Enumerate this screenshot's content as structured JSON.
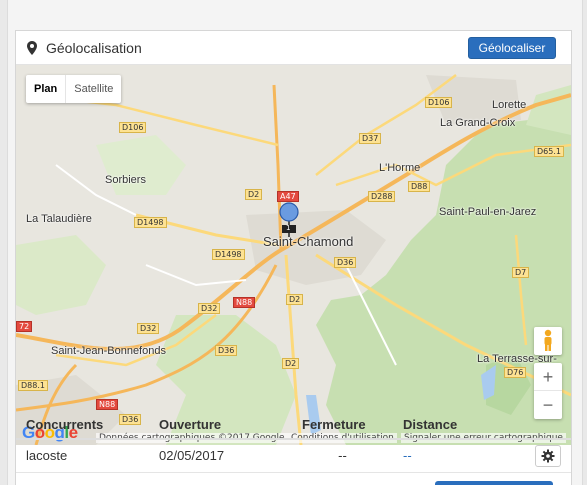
{
  "panel": {
    "title": "Géolocalisation",
    "geolocate_button": "Géolocaliser"
  },
  "map": {
    "type_plan": "Plan",
    "type_satellite": "Satellite",
    "zoom_in": "+",
    "zoom_out": "−",
    "google": "Google",
    "attrib_data": "Données cartographiques ©2017 Google",
    "attrib_terms": "Conditions d'utilisation",
    "attrib_report": "Signaler une erreur cartographique",
    "cities": {
      "lorette": "Lorette",
      "la_grand_croix": "La Grand-Croix",
      "sorbiers": "Sorbiers",
      "lhorme": "L'Horme",
      "la_talaudiere": "La Talaudière",
      "saint_paul": "Saint-Paul-en-Jarez",
      "saint_chamond": "Saint-Chamond",
      "saint_jean": "Saint-Jean-Bonnefonds",
      "la_terrasse": "La Terrasse-sur-"
    },
    "roads": {
      "d106a": "D106",
      "d106b": "D106",
      "d37": "D37",
      "d651": "D65.1",
      "d2a": "D2",
      "a47": "A47",
      "d288": "D288",
      "d88": "D88",
      "d1498a": "D1498",
      "d1498b": "D1498",
      "d36a": "D36",
      "d7": "D7",
      "n88a": "N88",
      "d32a": "D32",
      "d2b": "D2",
      "n72": "72",
      "d32b": "D32",
      "d36b": "D36",
      "d2c": "D2",
      "d76": "D76",
      "d881": "D88.1",
      "n88b": "N88",
      "d36c": "D36"
    },
    "marker_label": "1"
  },
  "table": {
    "headers": [
      "Concurrents",
      "Ouverture",
      "Fermeture",
      "Distance"
    ],
    "rows": [
      {
        "concurrent": "lacoste",
        "ouverture": "02/05/2017",
        "fermeture": "--",
        "distance": "--"
      }
    ]
  },
  "colors": {
    "accent": "#2a6ebd",
    "map_land": "#e8e6df",
    "map_green": "#c7dfb1",
    "road_yellow": "#fde293",
    "highway_orange": "#f5b75a"
  }
}
